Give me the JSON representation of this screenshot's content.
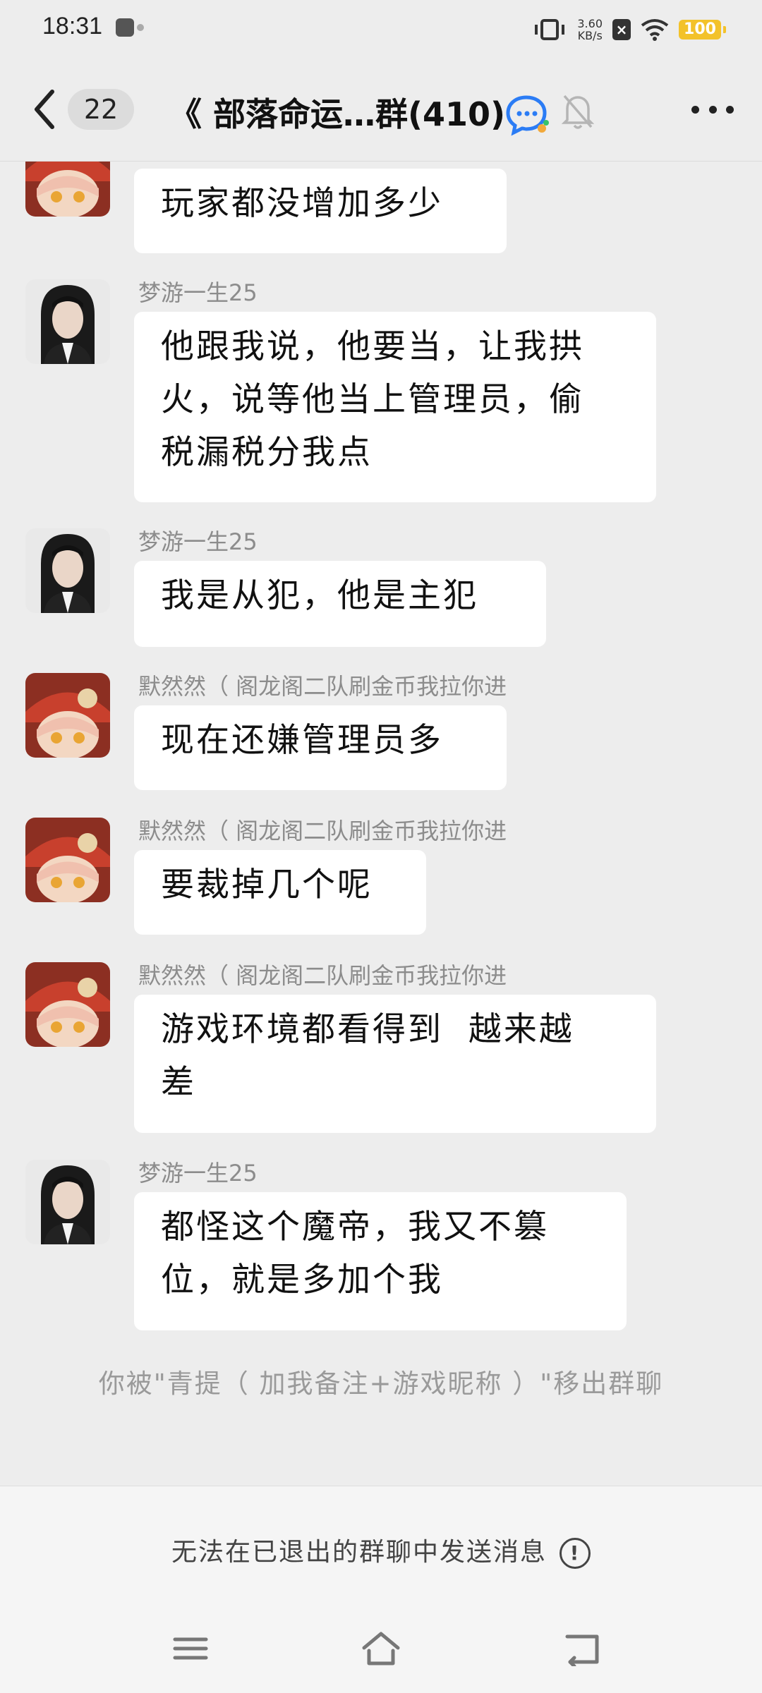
{
  "status_bar": {
    "time": "18:31",
    "net_speed_value": "3.60",
    "net_speed_unit": "KB/s",
    "battery": "100"
  },
  "nav": {
    "unread_count": "22",
    "title": "《 部落命运…群(410)"
  },
  "messages": [
    {
      "sender": "",
      "avatar": "anime-girl-red-hat",
      "text": "玩家都没增加多少"
    },
    {
      "sender": "梦游一生25",
      "avatar": "photo-girl",
      "text": "他跟我说，他要当，让我拱\n火，说等他当上管理员，偷\n税漏税分我点"
    },
    {
      "sender": "梦游一生25",
      "avatar": "photo-girl",
      "text": "我是从犯，他是主犯"
    },
    {
      "sender": "默然然（ 阁龙阁二队刷金币我拉你进",
      "avatar": "anime-girl-red-hat",
      "text": "现在还嫌管理员多"
    },
    {
      "sender": "默然然（ 阁龙阁二队刷金币我拉你进",
      "avatar": "anime-girl-red-hat",
      "text": "要裁掉几个呢"
    },
    {
      "sender": "默然然（ 阁龙阁二队刷金币我拉你进",
      "avatar": "anime-girl-red-hat",
      "text": "游戏环境都看得到  越来越\n差"
    },
    {
      "sender": "梦游一生25",
      "avatar": "photo-girl",
      "text": "都怪这个魔帝，我又不篡\n位，就是多加个我"
    }
  ],
  "system_message": "你被\"青提（ 加我备注+游戏昵称 ）\"移出群聊",
  "bottom_notice": "无法在已退出的群聊中发送消息",
  "colors": {
    "background": "#ededed",
    "bubble": "#ffffff",
    "battery": "#f3c22a"
  }
}
